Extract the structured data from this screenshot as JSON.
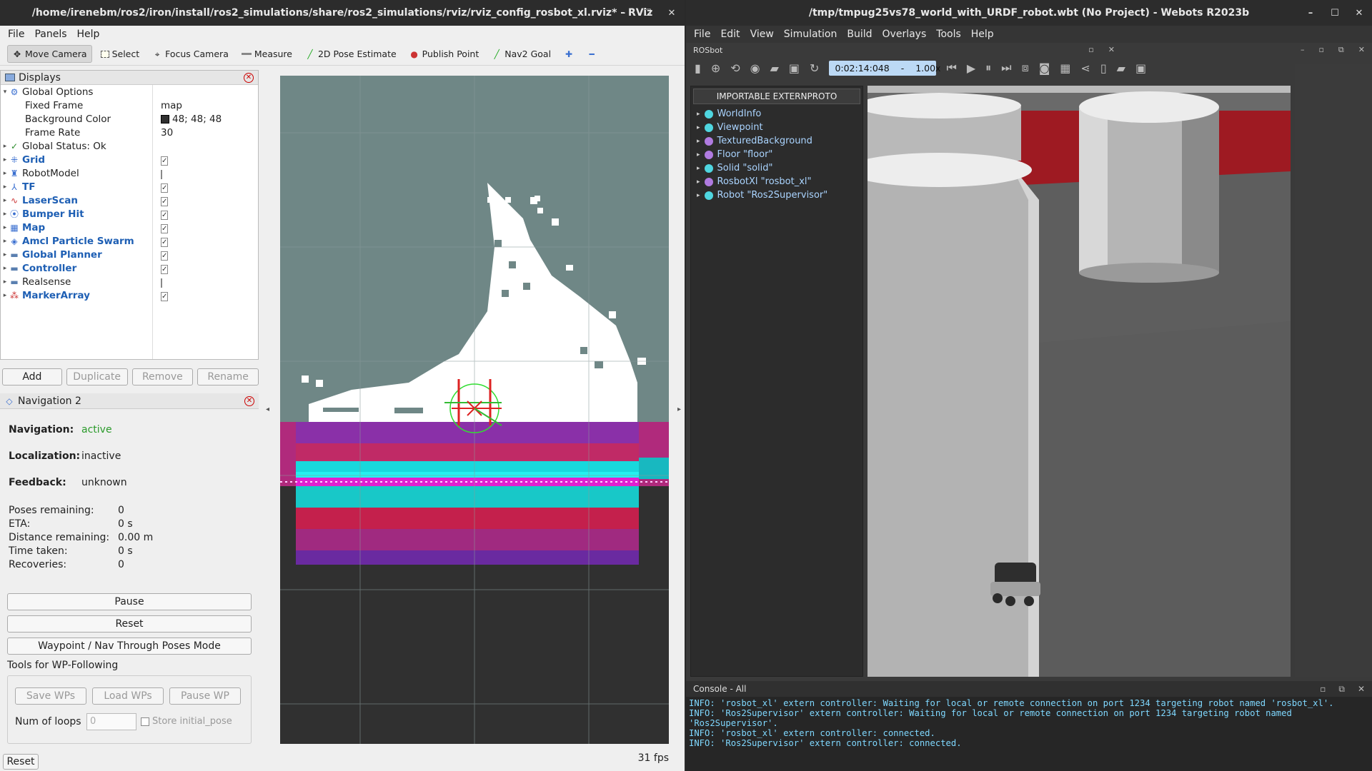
{
  "rviz": {
    "title": "/home/irenebm/ros2/iron/install/ros2_simulations/share/ros2_simulations/rviz/rviz_config_rosbot_xl.rviz* - RViz",
    "menu": [
      "File",
      "Panels",
      "Help"
    ],
    "toolbar": [
      "Move Camera",
      "Select",
      "Focus Camera",
      "Measure",
      "2D Pose Estimate",
      "Publish Point",
      "Nav2 Goal"
    ],
    "displays_title": "Displays",
    "global_options": "Global Options",
    "options": [
      {
        "label": "Fixed Frame",
        "value": "map"
      },
      {
        "label": "Background Color",
        "value": "48; 48; 48",
        "swatch": "#303030"
      },
      {
        "label": "Frame Rate",
        "value": "30"
      }
    ],
    "global_status": "Global Status: Ok",
    "items": [
      {
        "label": "Grid",
        "checked": "✓",
        "icon": "grid-icon",
        "color": "#1e5fb4"
      },
      {
        "label": "RobotModel",
        "checked": "",
        "icon": "robot-model-icon",
        "color": "#222"
      },
      {
        "label": "TF",
        "checked": "✓",
        "icon": "tf-icon",
        "color": "#1e5fb4"
      },
      {
        "label": "LaserScan",
        "checked": "✓",
        "icon": "laserscan-icon",
        "color": "#1e5fb4"
      },
      {
        "label": "Bumper Hit",
        "checked": "✓",
        "icon": "bumper-icon",
        "color": "#1e5fb4"
      },
      {
        "label": "Map",
        "checked": "✓",
        "icon": "map-icon",
        "color": "#1e5fb4"
      },
      {
        "label": "Amcl Particle Swarm",
        "checked": "✓",
        "icon": "particle-icon",
        "color": "#1e5fb4"
      },
      {
        "label": "Global Planner",
        "checked": "✓",
        "icon": "folder-icon",
        "color": "#1e5fb4"
      },
      {
        "label": "Controller",
        "checked": "✓",
        "icon": "folder-icon",
        "color": "#1e5fb4"
      },
      {
        "label": "Realsense",
        "checked": "",
        "icon": "folder-icon",
        "color": "#222"
      },
      {
        "label": "MarkerArray",
        "checked": "✓",
        "icon": "marker-icon",
        "color": "#1e5fb4"
      }
    ],
    "buttons": [
      "Add",
      "Duplicate",
      "Remove",
      "Rename"
    ],
    "nav_title": "Navigation 2",
    "navigation_label": "Navigation:",
    "navigation_value": "active",
    "localization_label": "Localization:",
    "localization_value": "inactive",
    "feedback_label": "Feedback:",
    "feedback_value": "unknown",
    "stats": [
      {
        "label": "Poses remaining:",
        "value": "0"
      },
      {
        "label": "ETA:",
        "value": "0 s"
      },
      {
        "label": "Distance remaining:",
        "value": "0.00 m"
      },
      {
        "label": "Time taken:",
        "value": "0 s"
      },
      {
        "label": "Recoveries:",
        "value": "0"
      }
    ],
    "pause": "Pause",
    "reset": "Reset",
    "waypoint_mode": "Waypoint / Nav Through Poses Mode",
    "wp_tools": "Tools for WP-Following",
    "save_wps": "Save WPs",
    "load_wps": "Load WPs",
    "pause_wp": "Pause WP",
    "num_loops": "Num of loops",
    "num_loops_value": "0",
    "store_initial": "Store initial_pose",
    "bottom_reset": "Reset",
    "fps": "31 fps"
  },
  "webots": {
    "title": "/tmp/tmpug25vs78_world_with_URDF_robot.wbt (No Project) - Webots R2023b",
    "menu": [
      "File",
      "Edit",
      "View",
      "Simulation",
      "Build",
      "Overlays",
      "Tools",
      "Help"
    ],
    "subtitle": "ROSbot",
    "time": "0:02:14:048",
    "speed": "1.00x",
    "proto_button": "IMPORTABLE EXTERNPROTO",
    "scene": [
      {
        "label": "WorldInfo",
        "color": "#4fd6e0"
      },
      {
        "label": "Viewpoint",
        "color": "#4fd6e0"
      },
      {
        "label": "TexturedBackground",
        "color": "#b07be0"
      },
      {
        "label": "Floor \"floor\"",
        "color": "#b07be0"
      },
      {
        "label": "Solid \"solid\"",
        "color": "#4fd6e0"
      },
      {
        "label": "RosbotXl \"rosbot_xl\"",
        "color": "#b07be0"
      },
      {
        "label": "Robot \"Ros2Supervisor\"",
        "color": "#4fd6e0"
      }
    ],
    "console_title": "Console - All",
    "console": [
      "INFO: 'rosbot_xl' extern controller: Waiting for local or remote connection on port 1234 targeting robot named 'rosbot_xl'.",
      "INFO: 'Ros2Supervisor' extern controller: Waiting for local or remote connection on port 1234 targeting robot named",
      "'Ros2Supervisor'.",
      "INFO: 'rosbot_xl' extern controller: connected.",
      "INFO: 'Ros2Supervisor' extern controller: connected."
    ]
  }
}
